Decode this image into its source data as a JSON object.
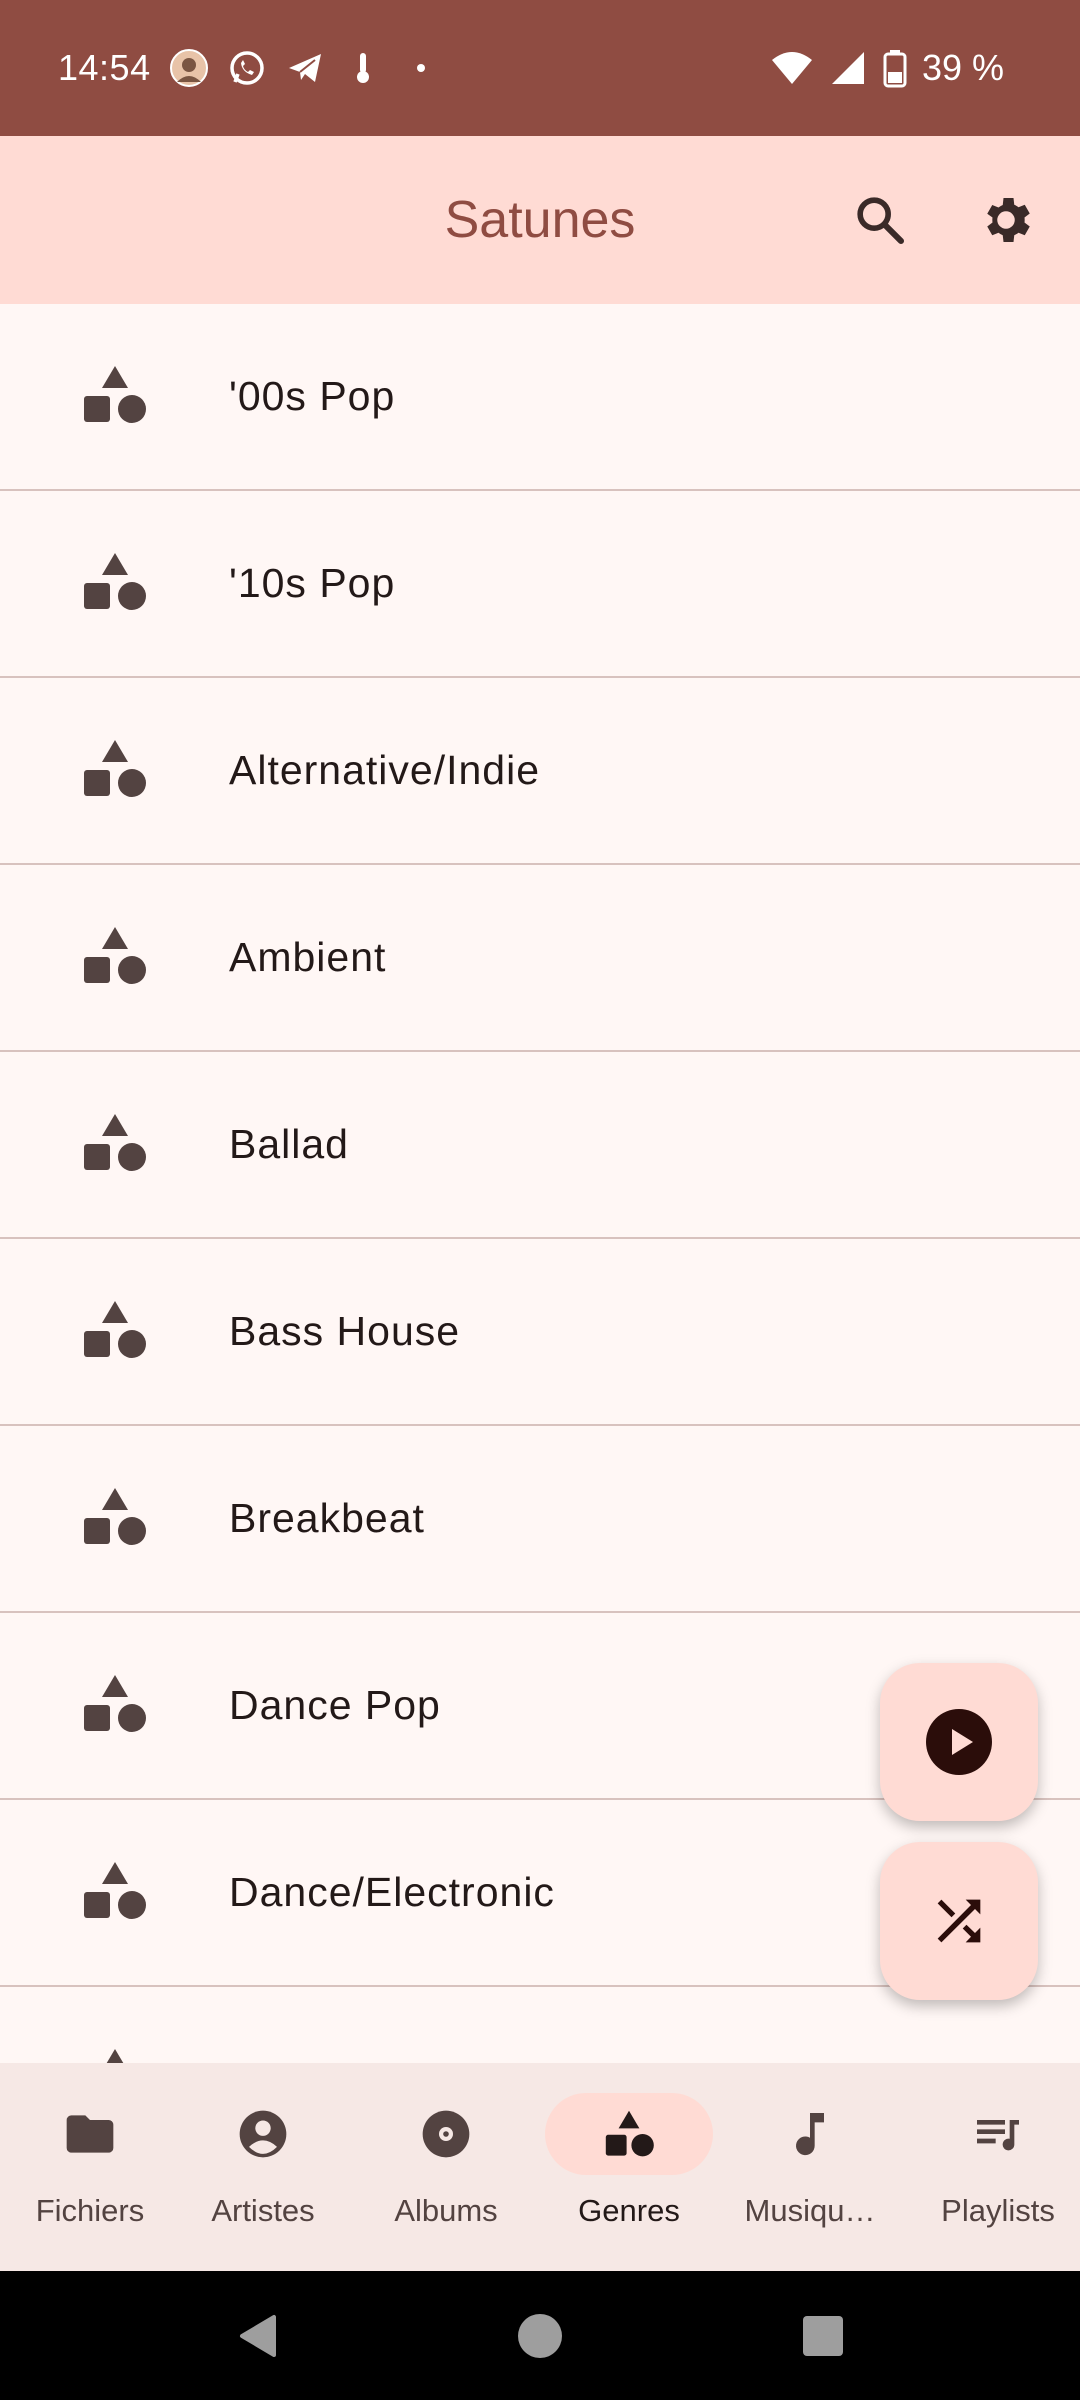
{
  "status_bar": {
    "time": "14:54",
    "battery": "39 %",
    "icons": [
      "avatar-icon",
      "whatsapp-icon",
      "telegram-icon",
      "thermometer-icon",
      "dot-icon",
      "wifi-icon",
      "signal-icon",
      "battery-icon"
    ]
  },
  "app_bar": {
    "title": "Satunes",
    "actions": [
      "search-icon",
      "settings-gear-icon"
    ]
  },
  "genres": [
    {
      "label": "'00s Pop"
    },
    {
      "label": "'10s Pop"
    },
    {
      "label": "Alternative/Indie"
    },
    {
      "label": "Ambient"
    },
    {
      "label": "Ballad"
    },
    {
      "label": "Bass House"
    },
    {
      "label": "Breakbeat"
    },
    {
      "label": "Dance Pop"
    },
    {
      "label": "Dance/Electronic"
    },
    {
      "label": ""
    }
  ],
  "fabs": [
    "play-icon",
    "shuffle-icon"
  ],
  "bottom_nav": {
    "items": [
      {
        "label": "Fichiers",
        "icon": "folder-icon"
      },
      {
        "label": "Artistes",
        "icon": "account-circle-icon"
      },
      {
        "label": "Albums",
        "icon": "album-icon"
      },
      {
        "label": "Genres",
        "icon": "category-icon",
        "active": true
      },
      {
        "label": "Musiqu…",
        "icon": "music-note-icon"
      },
      {
        "label": "Playlists",
        "icon": "playlist-icon"
      }
    ]
  },
  "colors": {
    "status_bar": "#8f4c42",
    "app_bar": "#ffdbd4",
    "background": "#fff7f5",
    "icon": "#534341",
    "title": "#8f4c42"
  }
}
